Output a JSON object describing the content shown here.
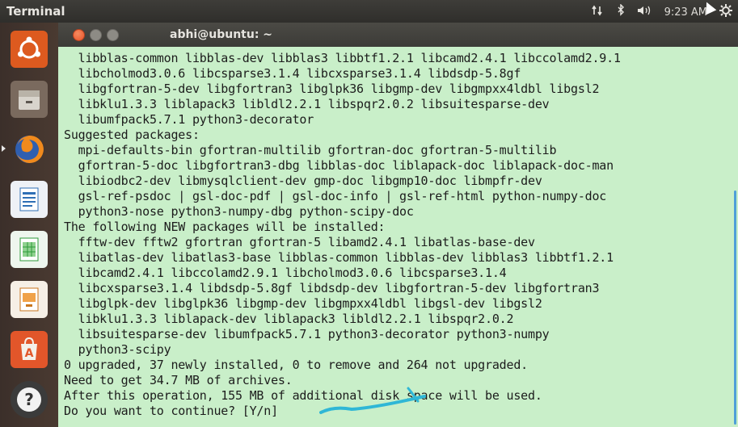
{
  "panel": {
    "app_title": "Terminal",
    "clock": "9:23 AM",
    "indicators": [
      "network-icon",
      "bluetooth-icon",
      "volume-icon",
      "gear-icon"
    ]
  },
  "launcher": {
    "items": [
      "ubuntu-dash",
      "files",
      "firefox",
      "libreoffice-writer",
      "libreoffice-calc",
      "libreoffice-impress",
      "ubuntu-software",
      "help"
    ]
  },
  "window": {
    "title": "abhi@ubuntu: ~"
  },
  "terminal": {
    "lines": [
      "  libblas-common libblas-dev libblas3 libbtf1.2.1 libcamd2.4.1 libccolamd2.9.1",
      "  libcholmod3.0.6 libcsparse3.1.4 libcxsparse3.1.4 libdsdp-5.8gf",
      "  libgfortran-5-dev libgfortran3 libglpk36 libgmp-dev libgmpxx4ldbl libgsl2",
      "  libklu1.3.3 liblapack3 libldl2.2.1 libspqr2.0.2 libsuitesparse-dev",
      "  libumfpack5.7.1 python3-decorator",
      "Suggested packages:",
      "  mpi-defaults-bin gfortran-multilib gfortran-doc gfortran-5-multilib",
      "  gfortran-5-doc libgfortran3-dbg libblas-doc liblapack-doc liblapack-doc-man",
      "  libiodbc2-dev libmysqlclient-dev gmp-doc libgmp10-doc libmpfr-dev",
      "  gsl-ref-psdoc | gsl-doc-pdf | gsl-doc-info | gsl-ref-html python-numpy-doc",
      "  python3-nose python3-numpy-dbg python-scipy-doc",
      "The following NEW packages will be installed:",
      "  fftw-dev fftw2 gfortran gfortran-5 libamd2.4.1 libatlas-base-dev",
      "  libatlas-dev libatlas3-base libblas-common libblas-dev libblas3 libbtf1.2.1",
      "  libcamd2.4.1 libccolamd2.9.1 libcholmod3.0.6 libcsparse3.1.4",
      "  libcxsparse3.1.4 libdsdp-5.8gf libdsdp-dev libgfortran-5-dev libgfortran3",
      "  libglpk-dev libglpk36 libgmp-dev libgmpxx4ldbl libgsl-dev libgsl2",
      "  libklu1.3.3 liblapack-dev liblapack3 libldl2.2.1 libspqr2.0.2",
      "  libsuitesparse-dev libumfpack5.7.1 python3-decorator python3-numpy",
      "  python3-scipy",
      "0 upgraded, 37 newly installed, 0 to remove and 264 not upgraded.",
      "Need to get 34.7 MB of archives.",
      "After this operation, 155 MB of additional disk space will be used.",
      "Do you want to continue? [Y/n]"
    ]
  },
  "colors": {
    "terminal_bg": "#c9efc9",
    "annotation": "#2fb7d6",
    "close_button": "#e9542a"
  }
}
